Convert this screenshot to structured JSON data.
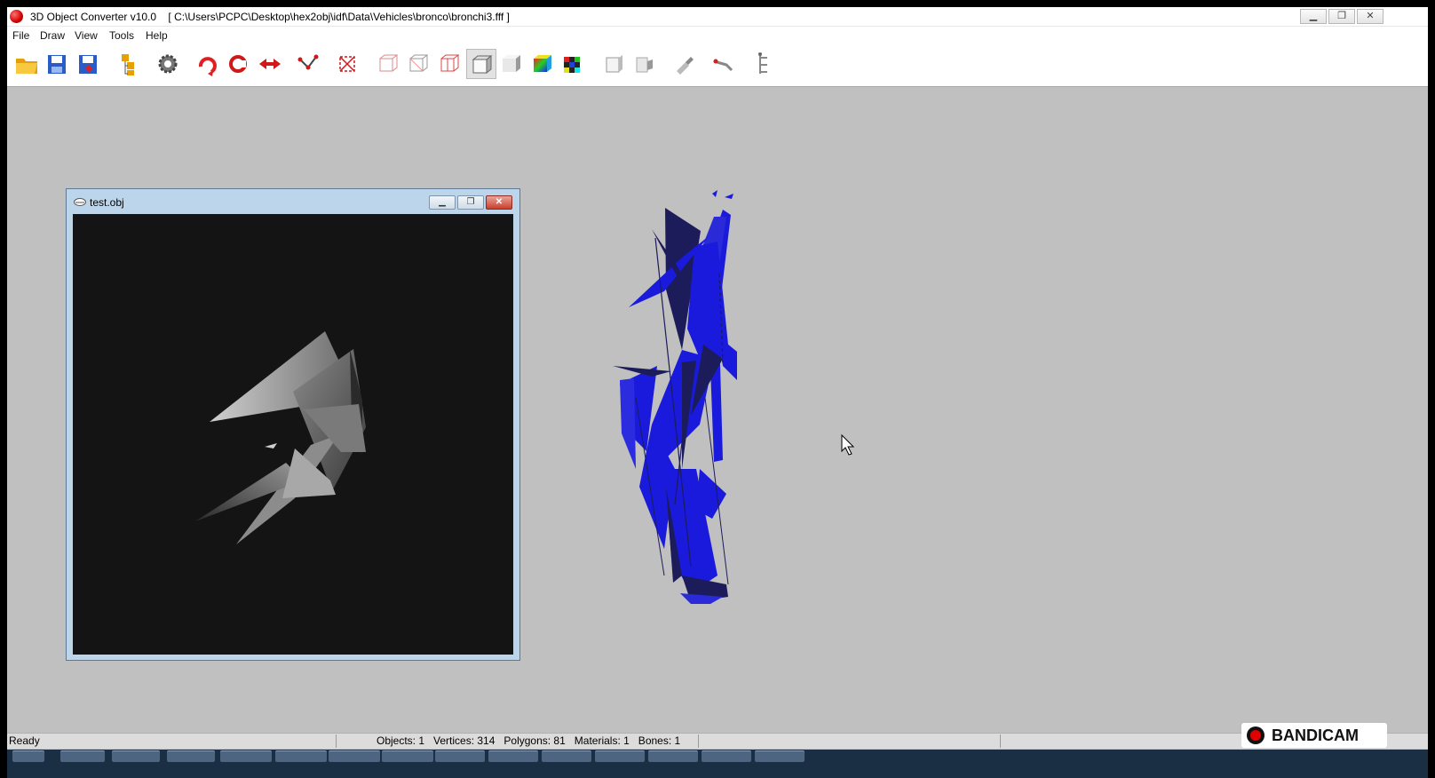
{
  "window": {
    "app_name": "3D Object Converter v10.0",
    "file_path": "[ C:\\Users\\PCPC\\Desktop\\hex2obj\\idf\\Data\\Vehicles\\bronco\\bronchi3.fff ]",
    "minimize_glyph": "▁",
    "restore_glyph": "❐",
    "close_glyph": "✕"
  },
  "menu": {
    "items": [
      "File",
      "Draw",
      "View",
      "Tools",
      "Help"
    ]
  },
  "toolbar": {
    "buttons": [
      "open-folder-icon",
      "save-icon",
      "save-as-icon",
      "object-tree-icon",
      "settings-gear-icon",
      "rotate-icon",
      "orbit-icon",
      "move-icon",
      "edge-icon",
      "vertex-icon",
      "wireframe-box-icon",
      "wireframe-box-gray-icon",
      "wireframe-box-red-icon",
      "solid-cube-icon",
      "shaded-cube-icon",
      "color-cube-icon",
      "texture-cube-icon",
      "box-front-icon",
      "box-side-icon",
      "brush-icon",
      "bone-icon",
      "hierarchy-icon"
    ],
    "active_button": "solid-cube-icon"
  },
  "child_window": {
    "title": "test.obj",
    "minimize_glyph": "▁",
    "restore_glyph": "❐",
    "close_glyph": "✕",
    "background": "#141414"
  },
  "viewport": {
    "model_color": "#1a1adc",
    "dark_color": "#1c1c5a"
  },
  "statusbar": {
    "ready": "Ready",
    "stats": "Objects: 1   Vertices: 314   Polygons: 81   Materials: 1   Bones: 1"
  },
  "watermark": {
    "text": "BANDICAM"
  }
}
